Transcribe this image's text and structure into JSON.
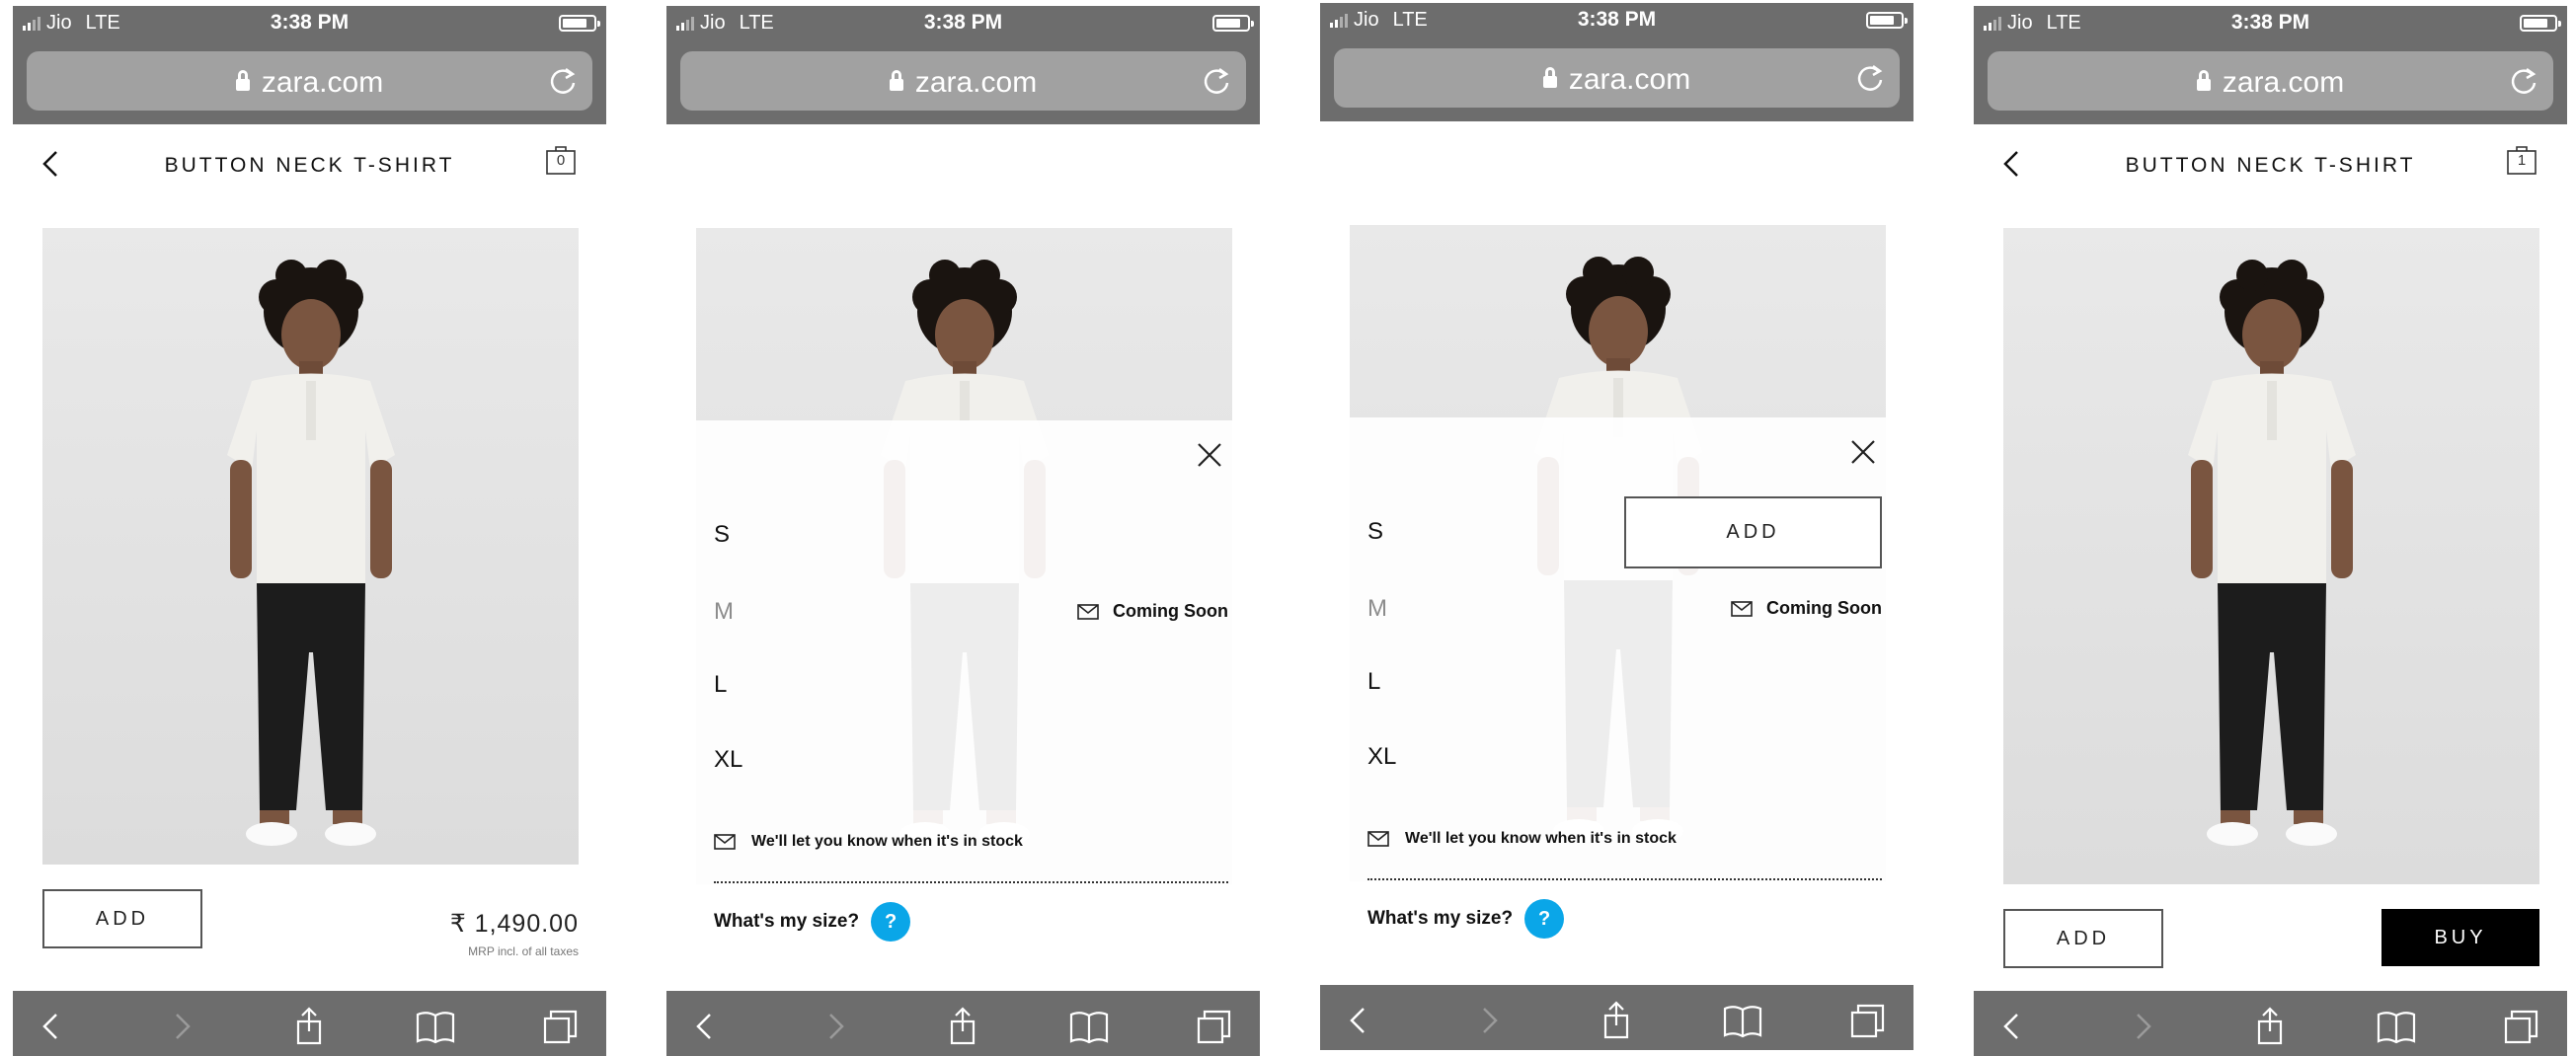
{
  "status_bar": {
    "carrier": "Jio",
    "network": "LTE",
    "time": "3:38 PM"
  },
  "browser": {
    "url": "zara.com"
  },
  "product": {
    "title": "BUTTON NECK T-SHIRT",
    "price": "₹ 1,490.00",
    "price_note": "MRP incl. of all taxes"
  },
  "screens": [
    {
      "cart_count": "0",
      "add_label": "ADD"
    },
    {},
    {
      "add_label": "ADD"
    },
    {
      "cart_count": "1",
      "add_label": "ADD",
      "buy_label": "BUY"
    }
  ],
  "size_panel": {
    "sizes": [
      {
        "label": "S",
        "available": true
      },
      {
        "label": "M",
        "available": false
      },
      {
        "label": "L",
        "available": true
      },
      {
        "label": "XL",
        "available": true
      }
    ],
    "coming_soon": "Coming Soon",
    "notify_text": "We'll let you know when it's in stock",
    "whats_my_size": "What's my size?",
    "help_glyph": "?"
  },
  "colors": {
    "chrome": "#6d6d6d",
    "url_pill": "#a1a1a1",
    "help_blue": "#0aa6e8",
    "buy_black": "#000000"
  },
  "icons": [
    "back-chevron-icon",
    "bag-icon",
    "close-icon",
    "envelope-icon",
    "lock-icon",
    "reload-icon",
    "share-icon",
    "bookmarks-icon",
    "tabs-icon",
    "forward-chevron-icon"
  ]
}
